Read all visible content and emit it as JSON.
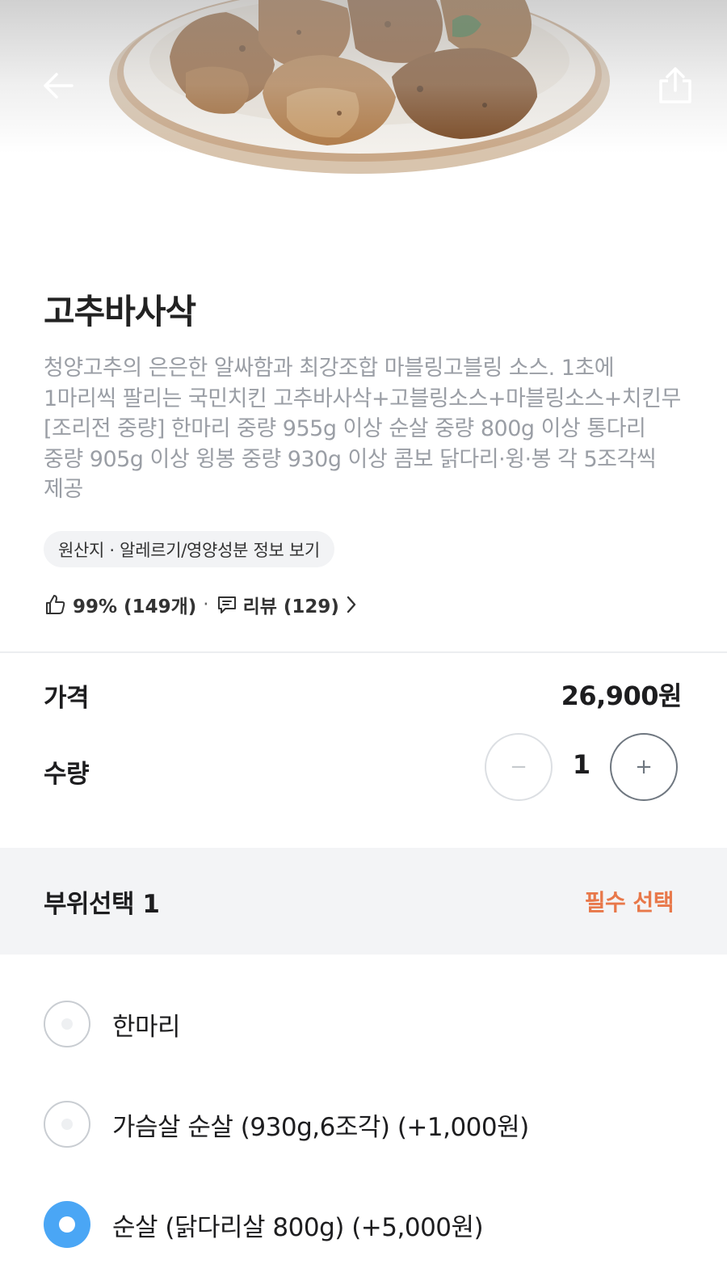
{
  "header": {
    "back_icon": "back-arrow-icon",
    "share_icon": "share-icon"
  },
  "product": {
    "name": "고추바사삭",
    "description": "청양고추의 은은한 알싸함과 최강조합 마블링고블링 소스. 1초에 1마리씩 팔리는 국민치킨 고추바사삭+고블링소스+마블링소스+치킨무 [조리전 중량] 한마리 중량 955g 이상 순살 중량 800g 이상 통다리 중량 905g 이상 윙봉 중량 930g 이상 콤보 닭다리·윙·봉 각 5조각씩 제공",
    "info_chip": "원산지 · 알레르기/영양성분 정보 보기",
    "like_rate": "99% (149개)",
    "separator": "·",
    "review_label": "리뷰 (129)"
  },
  "order": {
    "price_label": "가격",
    "price_value": "26,900원",
    "qty_label": "수량",
    "qty_value": "1",
    "minus": "−",
    "plus": "+"
  },
  "options": {
    "title": "부위선택 1",
    "required": "필수 선택",
    "items": [
      {
        "label": "한마리",
        "selected": false
      },
      {
        "label": "가슴살 순살 (930g,6조각) (+1,000원)",
        "selected": false
      },
      {
        "label": "순살 (닭다리살 800g) (+5,000원)",
        "selected": true
      }
    ]
  },
  "colors": {
    "accent_blue": "#4aa6f5",
    "required_orange": "#e8784a",
    "description_gray": "#9a9ea5"
  }
}
